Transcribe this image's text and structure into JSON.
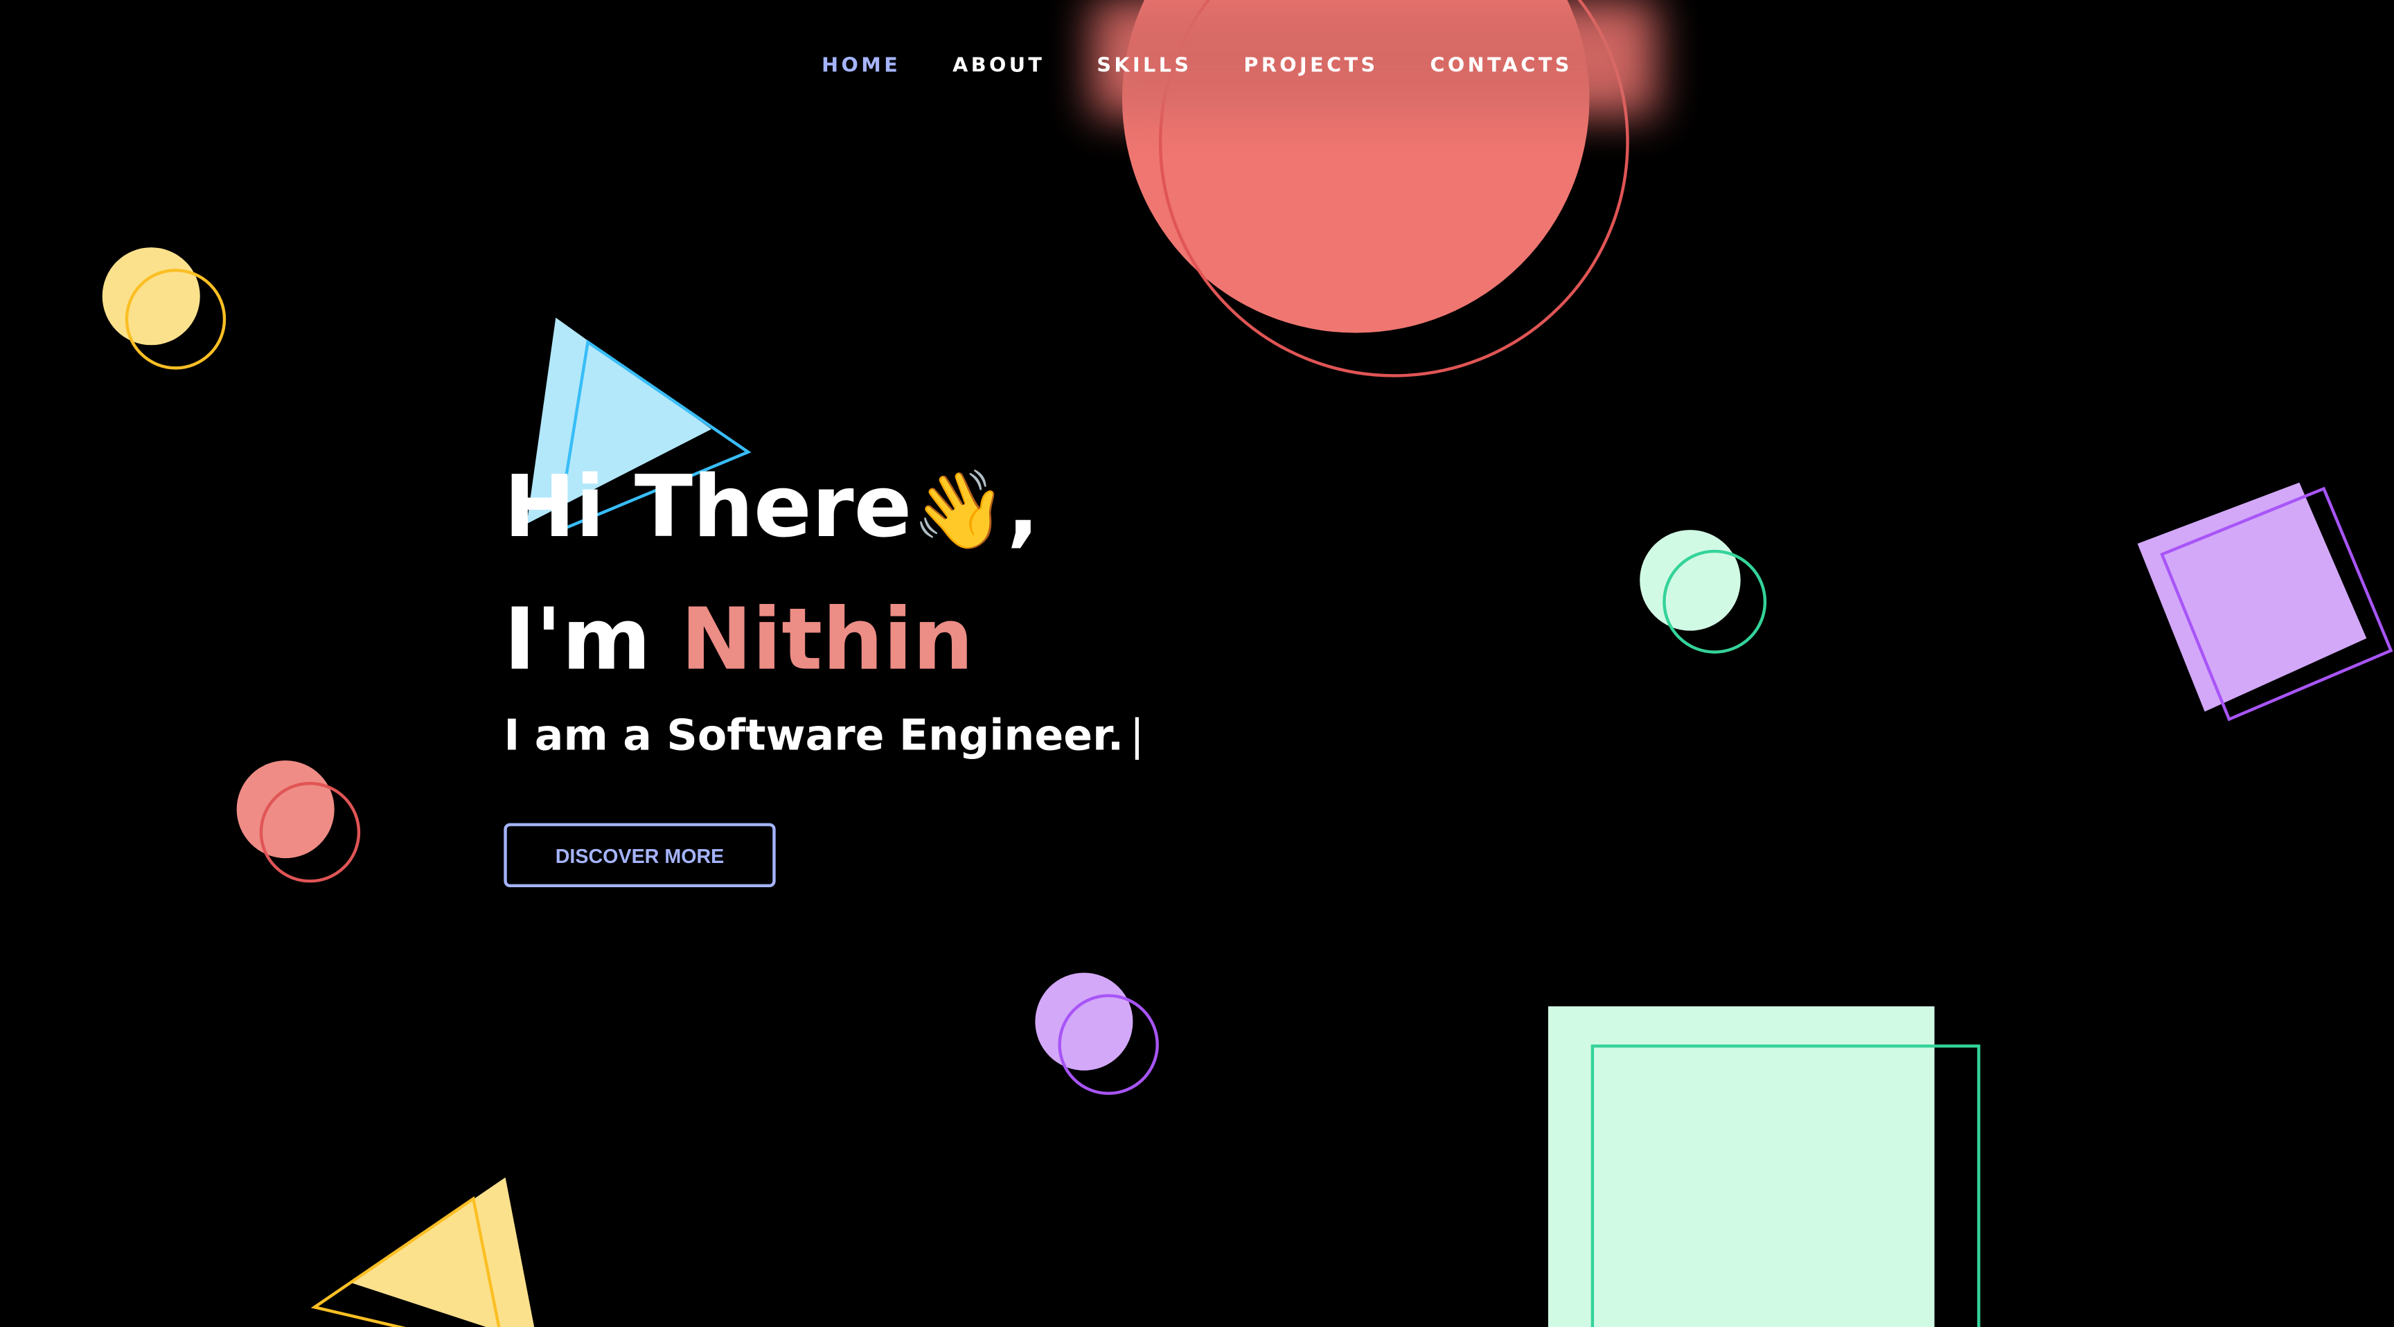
{
  "nav": {
    "items": [
      {
        "label": "HOME",
        "active": true
      },
      {
        "label": "ABOUT",
        "active": false
      },
      {
        "label": "SKILLS",
        "active": false
      },
      {
        "label": "PROJECTS",
        "active": false
      },
      {
        "label": "CONTACTS",
        "active": false
      }
    ]
  },
  "hero": {
    "greeting": "Hi There",
    "wave_emoji": "👋",
    "greeting_suffix": ",",
    "intro_prefix": "I'm ",
    "name": "Nithin",
    "tagline": "I am a Software Engineer.",
    "cursor": "|",
    "cta_label": "DISCOVER MORE"
  },
  "colors": {
    "background": "#000000",
    "nav_active": "#a5b4fc",
    "name_accent": "#ec8d86",
    "coral": "#ef7671",
    "yellow": "#fce18d",
    "sky": "#b3e8fb",
    "mint": "#d1fae5",
    "violet": "#d3a8f9"
  },
  "decor": {
    "shape_icons": [
      "circle-shape",
      "triangle-shape",
      "square-shape"
    ]
  }
}
